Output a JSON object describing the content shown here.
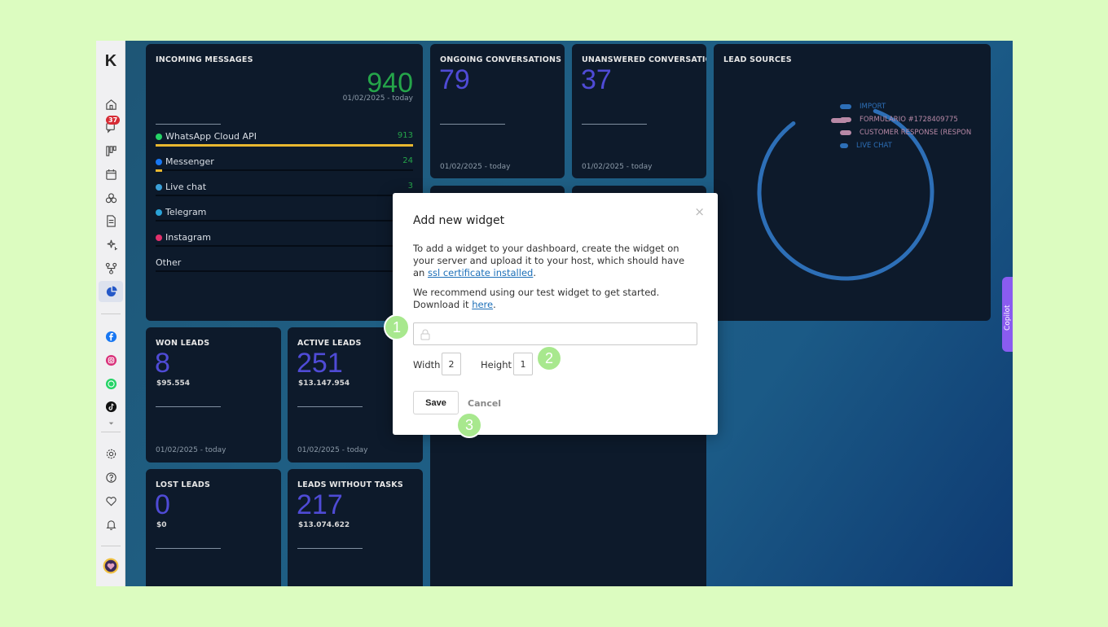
{
  "sidebar": {
    "logo": "K",
    "chat_badge": "37",
    "icons": [
      "home-icon",
      "chat-icon",
      "kanban-icon",
      "calendar-icon",
      "contacts-icon",
      "document-icon",
      "sparkles-icon",
      "workflow-icon",
      "pie-chart-icon",
      "facebook-icon",
      "instagram-icon",
      "whatsapp-icon",
      "tiktok-icon",
      "chevron-down-icon",
      "gear-icon",
      "help-icon",
      "heart-icon",
      "bell-icon",
      "avatar"
    ]
  },
  "cards": {
    "incoming": {
      "title": "INCOMING MESSAGES",
      "value": "940",
      "date": "01/02/2025 - today",
      "channels": [
        {
          "label": "WhatsApp Cloud API",
          "value": "913",
          "color": "#25d366",
          "fill": 1.0
        },
        {
          "label": "Messenger",
          "value": "24",
          "color": "#1877f2",
          "fill": 0.026
        },
        {
          "label": "Live chat",
          "value": "3",
          "color": "#3ba0d8",
          "fill": 0.0
        },
        {
          "label": "Telegram",
          "value": "",
          "color": "#2aa3d8",
          "fill": 0.0
        },
        {
          "label": "Instagram",
          "value": "",
          "color": "#e1306c",
          "fill": 0.0
        },
        {
          "label": "Other",
          "value": "",
          "color": "",
          "fill": 0.0
        }
      ]
    },
    "ongoing": {
      "title": "ONGOING CONVERSATIONS",
      "value": "79",
      "date": "01/02/2025 - today"
    },
    "unanswered": {
      "title": "UNANSWERED CONVERSATIO",
      "value": "37",
      "date": "01/02/2025 - today"
    },
    "lead_sources": {
      "title": "LEAD SOURCES",
      "legend": [
        {
          "label": "IMPORT",
          "color": "#2d6fb7"
        },
        {
          "label": "FORMULARIO #1728409775",
          "color": "#b889a6"
        },
        {
          "label": "CUSTOMER RESPONSE (RESPON",
          "color": "#b889a6"
        },
        {
          "label": "LIVE CHAT",
          "color": "#2d6fb7"
        }
      ]
    },
    "won": {
      "title": "WON LEADS",
      "value": "8",
      "money": "$95.554",
      "date": "01/02/2025 - today"
    },
    "active": {
      "title": "ACTIVE LEADS",
      "value": "251",
      "money": "$13.147.954",
      "date": "01/02/2025 - today"
    },
    "lost": {
      "title": "LOST LEADS",
      "value": "0",
      "money": "$0"
    },
    "without_tasks": {
      "title": "LEADS WITHOUT TASKS",
      "value": "217",
      "money": "$13.074.622"
    }
  },
  "copilot_label": "Copilot",
  "modal": {
    "title": "Add new widget",
    "close": "×",
    "p1_a": "To add a widget to your dashboard, create the widget on your server and upload it to your host, which should have an ",
    "p1_link": "ssl certificate installed",
    "p1_b": ".",
    "p2_a": "We recommend using our test widget to get started. Download it ",
    "p2_link": "here",
    "p2_b": ".",
    "url_placeholder": "",
    "width_label": "Width",
    "width_value": "2",
    "height_label": "Height",
    "height_value": "1",
    "save_label": "Save",
    "cancel_label": "Cancel"
  },
  "steps": [
    "1",
    "2",
    "3"
  ]
}
